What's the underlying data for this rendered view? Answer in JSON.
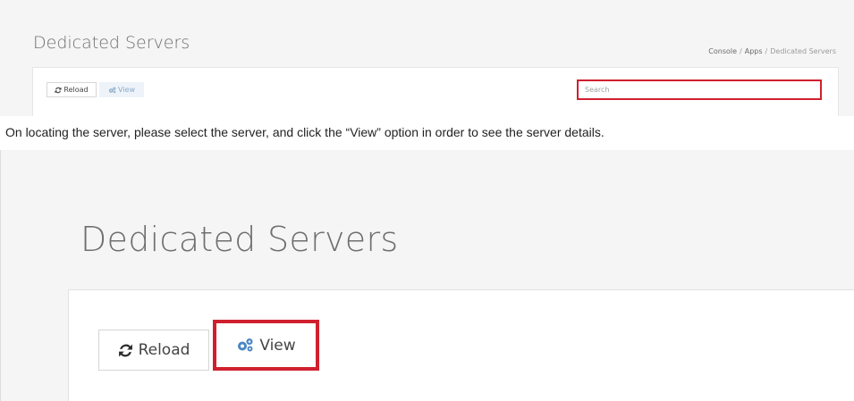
{
  "top_screenshot": {
    "page_title": "Dedicated Servers",
    "breadcrumb": [
      "Console",
      "Apps",
      "Dedicated Servers"
    ],
    "toolbar": {
      "reload_label": "Reload",
      "view_label": "View"
    },
    "search": {
      "placeholder": "Search",
      "value": ""
    }
  },
  "caption": "On locating the server, please select the server, and click the “View” option in order to see the server details.",
  "zoom_screenshot": {
    "page_title": "Dedicated Servers",
    "toolbar": {
      "reload_label": "Reload",
      "view_label": "View"
    }
  },
  "colors": {
    "highlight": "#d0202e",
    "view_icon": "#4a86c5",
    "background": "#f5f5f5"
  },
  "icons": [
    "reload-icon",
    "cogs-icon"
  ]
}
